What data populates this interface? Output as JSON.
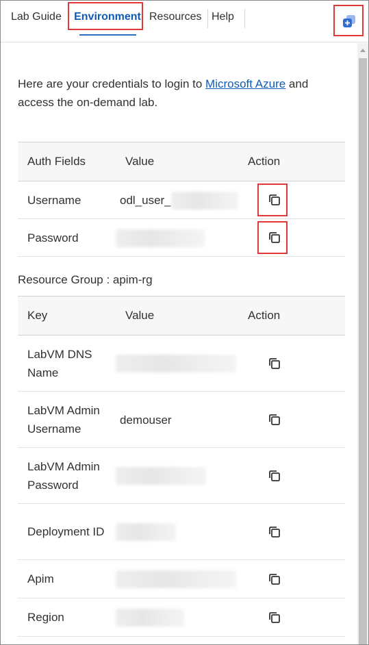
{
  "tabs": [
    {
      "label": "Lab Guide"
    },
    {
      "label": "Environment"
    },
    {
      "label": "Resources"
    },
    {
      "label": "Help"
    }
  ],
  "active_tab": "Environment",
  "intro": {
    "before_link": "Here are your credentials to login to ",
    "link_text": "Microsoft Azure",
    "after_link": " and access the on-demand lab."
  },
  "auth_table": {
    "headers": [
      "Auth Fields",
      "Value",
      "Action"
    ],
    "rows": [
      {
        "field": "Username",
        "value": "odl_user_",
        "value_redacted": true
      },
      {
        "field": "Password",
        "value": "",
        "value_redacted": true
      }
    ]
  },
  "resource_group": {
    "heading": "Resource Group : apim-rg"
  },
  "rg_table": {
    "headers": [
      "Key",
      "Value",
      "Action"
    ],
    "rows": [
      {
        "key": "LabVM DNS Name",
        "value": "",
        "value_redacted": true
      },
      {
        "key": "LabVM Admin Username",
        "value": "demouser",
        "value_redacted": false
      },
      {
        "key": "LabVM Admin Password",
        "value": "",
        "value_redacted": true
      },
      {
        "key": "Deployment ID",
        "value": "",
        "value_redacted": true
      },
      {
        "key": "Apim",
        "value": "",
        "value_redacted": true
      },
      {
        "key": "Region",
        "value": "",
        "value_redacted": true
      }
    ]
  },
  "icons": {
    "copy": "copy-icon",
    "popout": "popout-window-icon"
  },
  "colors": {
    "accent": "#0f5bb5",
    "highlight": "#e03838",
    "popout": "#2f6fd0"
  }
}
